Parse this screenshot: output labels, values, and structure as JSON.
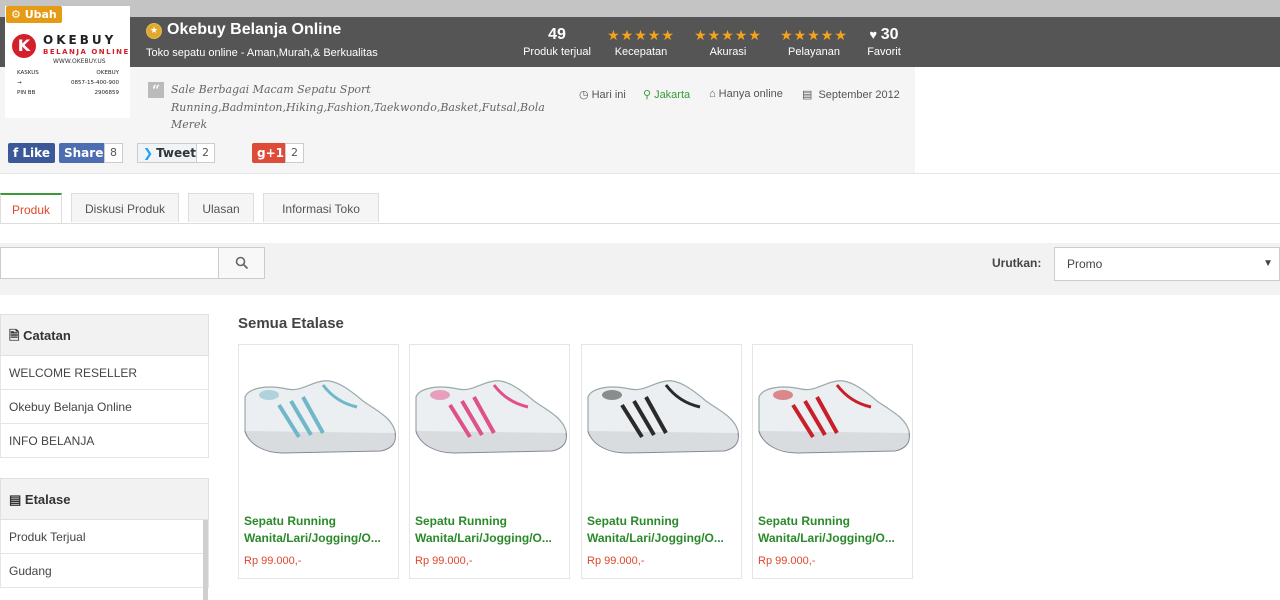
{
  "shop": {
    "change_label": "Ubah",
    "logo": {
      "mark": "K",
      "name": "OKEBUY",
      "subtitle": "BELANJA ONLINE",
      "web": "WWW.OKEBUY.US",
      "contacts": [
        {
          "label": "KASKUS",
          "value": "OKEBUY"
        },
        {
          "label": "→",
          "value": "0857-15-400-900"
        },
        {
          "label": "PIN BB",
          "value": "2906859"
        }
      ]
    },
    "name": "Okebuy Belanja Online",
    "tagline": "Toko sepatu online - Aman,Murah,& Berkualitas",
    "description": "Sale Berbagai Macam Sepatu Sport Running,Badminton,Hiking,Fashion,Taekwondo,Basket,Futsal,Bola Merek",
    "meta": {
      "active": "Hari ini",
      "location": "Jakarta",
      "shipping": "Hanya online",
      "joined": "September 2012"
    }
  },
  "stats": {
    "sold": {
      "value": "49",
      "label": "Produk terjual"
    },
    "speed": {
      "stars": 5,
      "label": "Kecepatan"
    },
    "accuracy": {
      "stars": 5,
      "label": "Akurasi"
    },
    "service": {
      "stars": 5,
      "label": "Pelayanan"
    },
    "favorite": {
      "value": "30",
      "label": "Favorit"
    }
  },
  "social": {
    "like": "Like",
    "share": "Share",
    "share_count": "8",
    "tweet": "Tweet",
    "tweet_count": "2",
    "gplus": "+1",
    "gplus_count": "2"
  },
  "tabs": [
    {
      "label": "Produk",
      "active": true
    },
    {
      "label": "Diskusi Produk"
    },
    {
      "label": "Ulasan"
    },
    {
      "label": "Informasi Toko"
    }
  ],
  "search": {
    "placeholder": ""
  },
  "sort": {
    "label": "Urutkan:",
    "value": "Promo"
  },
  "sidebar": {
    "notes_title": "Catatan",
    "notes": [
      "WELCOME RESELLER",
      "Okebuy Belanja Online",
      "INFO BELANJA"
    ],
    "etalase_title": "Etalase",
    "etalase": [
      "Produk Terjual",
      "Gudang"
    ]
  },
  "main": {
    "section_title": "Semua Etalase",
    "products": [
      {
        "name1": "Sepatu Running",
        "name2": "Wanita/Lari/Jogging/O...",
        "price": "Rp 99.000,-",
        "accent": "#6fb8c9"
      },
      {
        "name1": "Sepatu Running",
        "name2": "Wanita/Lari/Jogging/O...",
        "price": "Rp 99.000,-",
        "accent": "#e0508a"
      },
      {
        "name1": "Sepatu Running",
        "name2": "Wanita/Lari/Jogging/O...",
        "price": "Rp 99.000,-",
        "accent": "#2a2a2a"
      },
      {
        "name1": "Sepatu Running",
        "name2": "Wanita/Lari/Jogging/O...",
        "price": "Rp 99.000,-",
        "accent": "#c8202a"
      }
    ]
  }
}
